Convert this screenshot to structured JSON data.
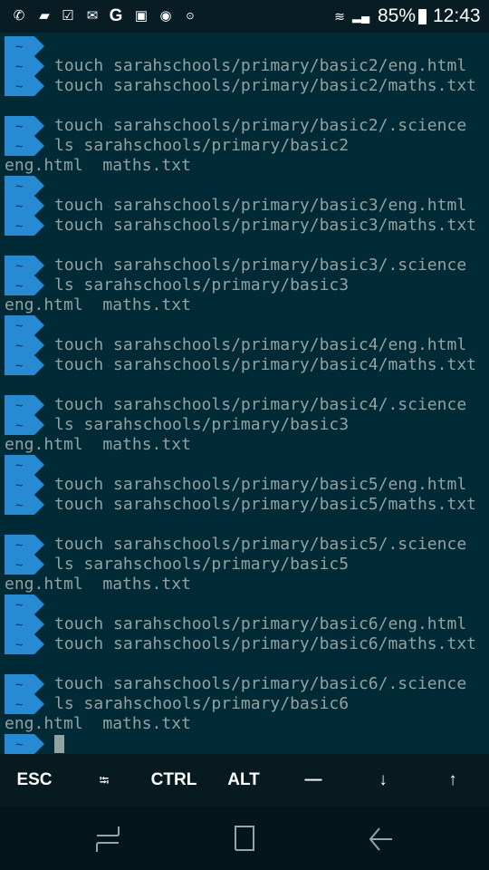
{
  "status_bar": {
    "notification_icons": [
      "whatsapp-icon",
      "message-icon",
      "clipboard-check-icon",
      "gmail-icon",
      "google-icon",
      "gallery-icon",
      "eye-app-icon",
      "terminal-icon"
    ],
    "battery": "85%",
    "time": "12:43"
  },
  "terminal": {
    "prompt_symbol": "~",
    "lines": [
      {
        "type": "prompt",
        "text": ""
      },
      {
        "type": "prompt",
        "text": "touch sarahschools/primary/basic2/eng.html"
      },
      {
        "type": "prompt",
        "text": "touch sarahschools/primary/basic2/maths.txt"
      },
      {
        "type": "blank",
        "text": ""
      },
      {
        "type": "prompt",
        "text": "touch sarahschools/primary/basic2/.science"
      },
      {
        "type": "prompt",
        "text": "ls sarahschools/primary/basic2"
      },
      {
        "type": "output",
        "text": "eng.html  maths.txt"
      },
      {
        "type": "prompt",
        "text": ""
      },
      {
        "type": "prompt",
        "text": "touch sarahschools/primary/basic3/eng.html"
      },
      {
        "type": "prompt",
        "text": "touch sarahschools/primary/basic3/maths.txt"
      },
      {
        "type": "blank",
        "text": ""
      },
      {
        "type": "prompt",
        "text": "touch sarahschools/primary/basic3/.science"
      },
      {
        "type": "prompt",
        "text": "ls sarahschools/primary/basic3"
      },
      {
        "type": "output",
        "text": "eng.html  maths.txt"
      },
      {
        "type": "prompt",
        "text": ""
      },
      {
        "type": "prompt",
        "text": "touch sarahschools/primary/basic4/eng.html"
      },
      {
        "type": "prompt",
        "text": "touch sarahschools/primary/basic4/maths.txt"
      },
      {
        "type": "blank",
        "text": ""
      },
      {
        "type": "prompt",
        "text": "touch sarahschools/primary/basic4/.science"
      },
      {
        "type": "prompt",
        "text": "ls sarahschools/primary/basic3"
      },
      {
        "type": "output",
        "text": "eng.html  maths.txt"
      },
      {
        "type": "prompt",
        "text": ""
      },
      {
        "type": "prompt",
        "text": "touch sarahschools/primary/basic5/eng.html"
      },
      {
        "type": "prompt",
        "text": "touch sarahschools/primary/basic5/maths.txt"
      },
      {
        "type": "blank",
        "text": ""
      },
      {
        "type": "prompt",
        "text": "touch sarahschools/primary/basic5/.science"
      },
      {
        "type": "prompt",
        "text": "ls sarahschools/primary/basic5"
      },
      {
        "type": "output",
        "text": "eng.html  maths.txt"
      },
      {
        "type": "prompt",
        "text": ""
      },
      {
        "type": "prompt",
        "text": "touch sarahschools/primary/basic6/eng.html"
      },
      {
        "type": "prompt",
        "text": "touch sarahschools/primary/basic6/maths.txt"
      },
      {
        "type": "blank",
        "text": ""
      },
      {
        "type": "prompt",
        "text": "touch sarahschools/primary/basic6/.science"
      },
      {
        "type": "prompt",
        "text": "ls sarahschools/primary/basic6"
      },
      {
        "type": "output",
        "text": "eng.html  maths.txt"
      },
      {
        "type": "cursor",
        "text": ""
      }
    ]
  },
  "extra_keys": {
    "esc": "ESC",
    "tab": "⭾",
    "ctrl": "CTRL",
    "alt": "ALT",
    "dash": "—",
    "down": "↓",
    "up": "↑"
  },
  "colors": {
    "background": "#002b36",
    "prompt": "#268bd2",
    "text": "#93a1a1"
  }
}
